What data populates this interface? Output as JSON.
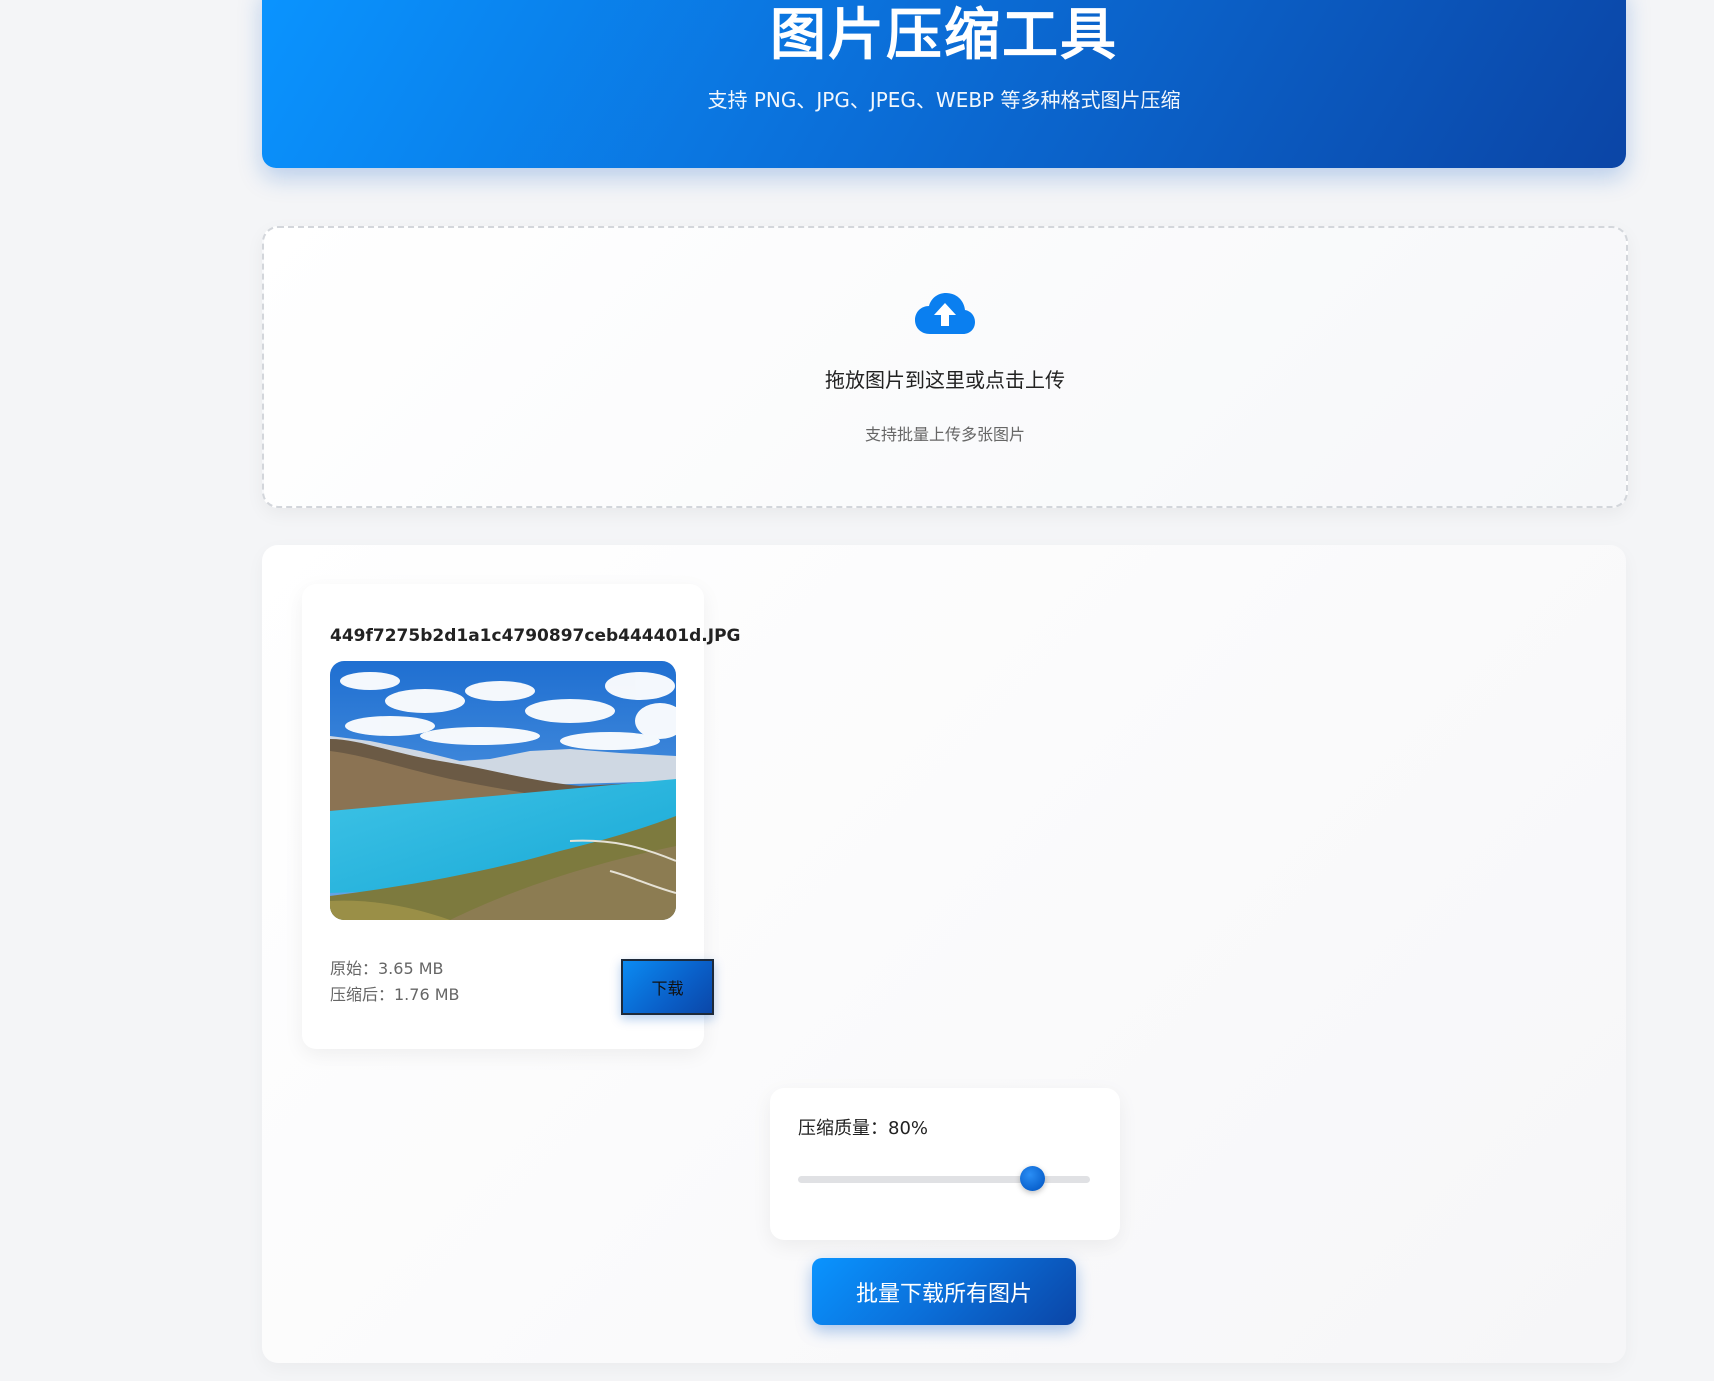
{
  "header": {
    "title": "图片压缩工具",
    "subtitle": "支持 PNG、JPG、JPEG、WEBP 等多种格式图片压缩"
  },
  "upload": {
    "icon": "cloud-upload-icon",
    "title": "拖放图片到这里或点击上传",
    "hint": "支持批量上传多张图片"
  },
  "images": [
    {
      "file_name": "449f7275b2d1a1c4790897ceb444401d.JPG",
      "original_label": "原始：3.65 MB",
      "compressed_label": "压缩后：1.76 MB",
      "download_label": "下载"
    }
  ],
  "quality": {
    "label": "压缩质量：80%",
    "value": 80,
    "min": 0,
    "max": 100
  },
  "batch_download_label": "批量下载所有图片",
  "colors": {
    "brand_start": "#0a94ff",
    "brand_end": "#0b45a6",
    "upload_icon": "#0a7ff0"
  }
}
